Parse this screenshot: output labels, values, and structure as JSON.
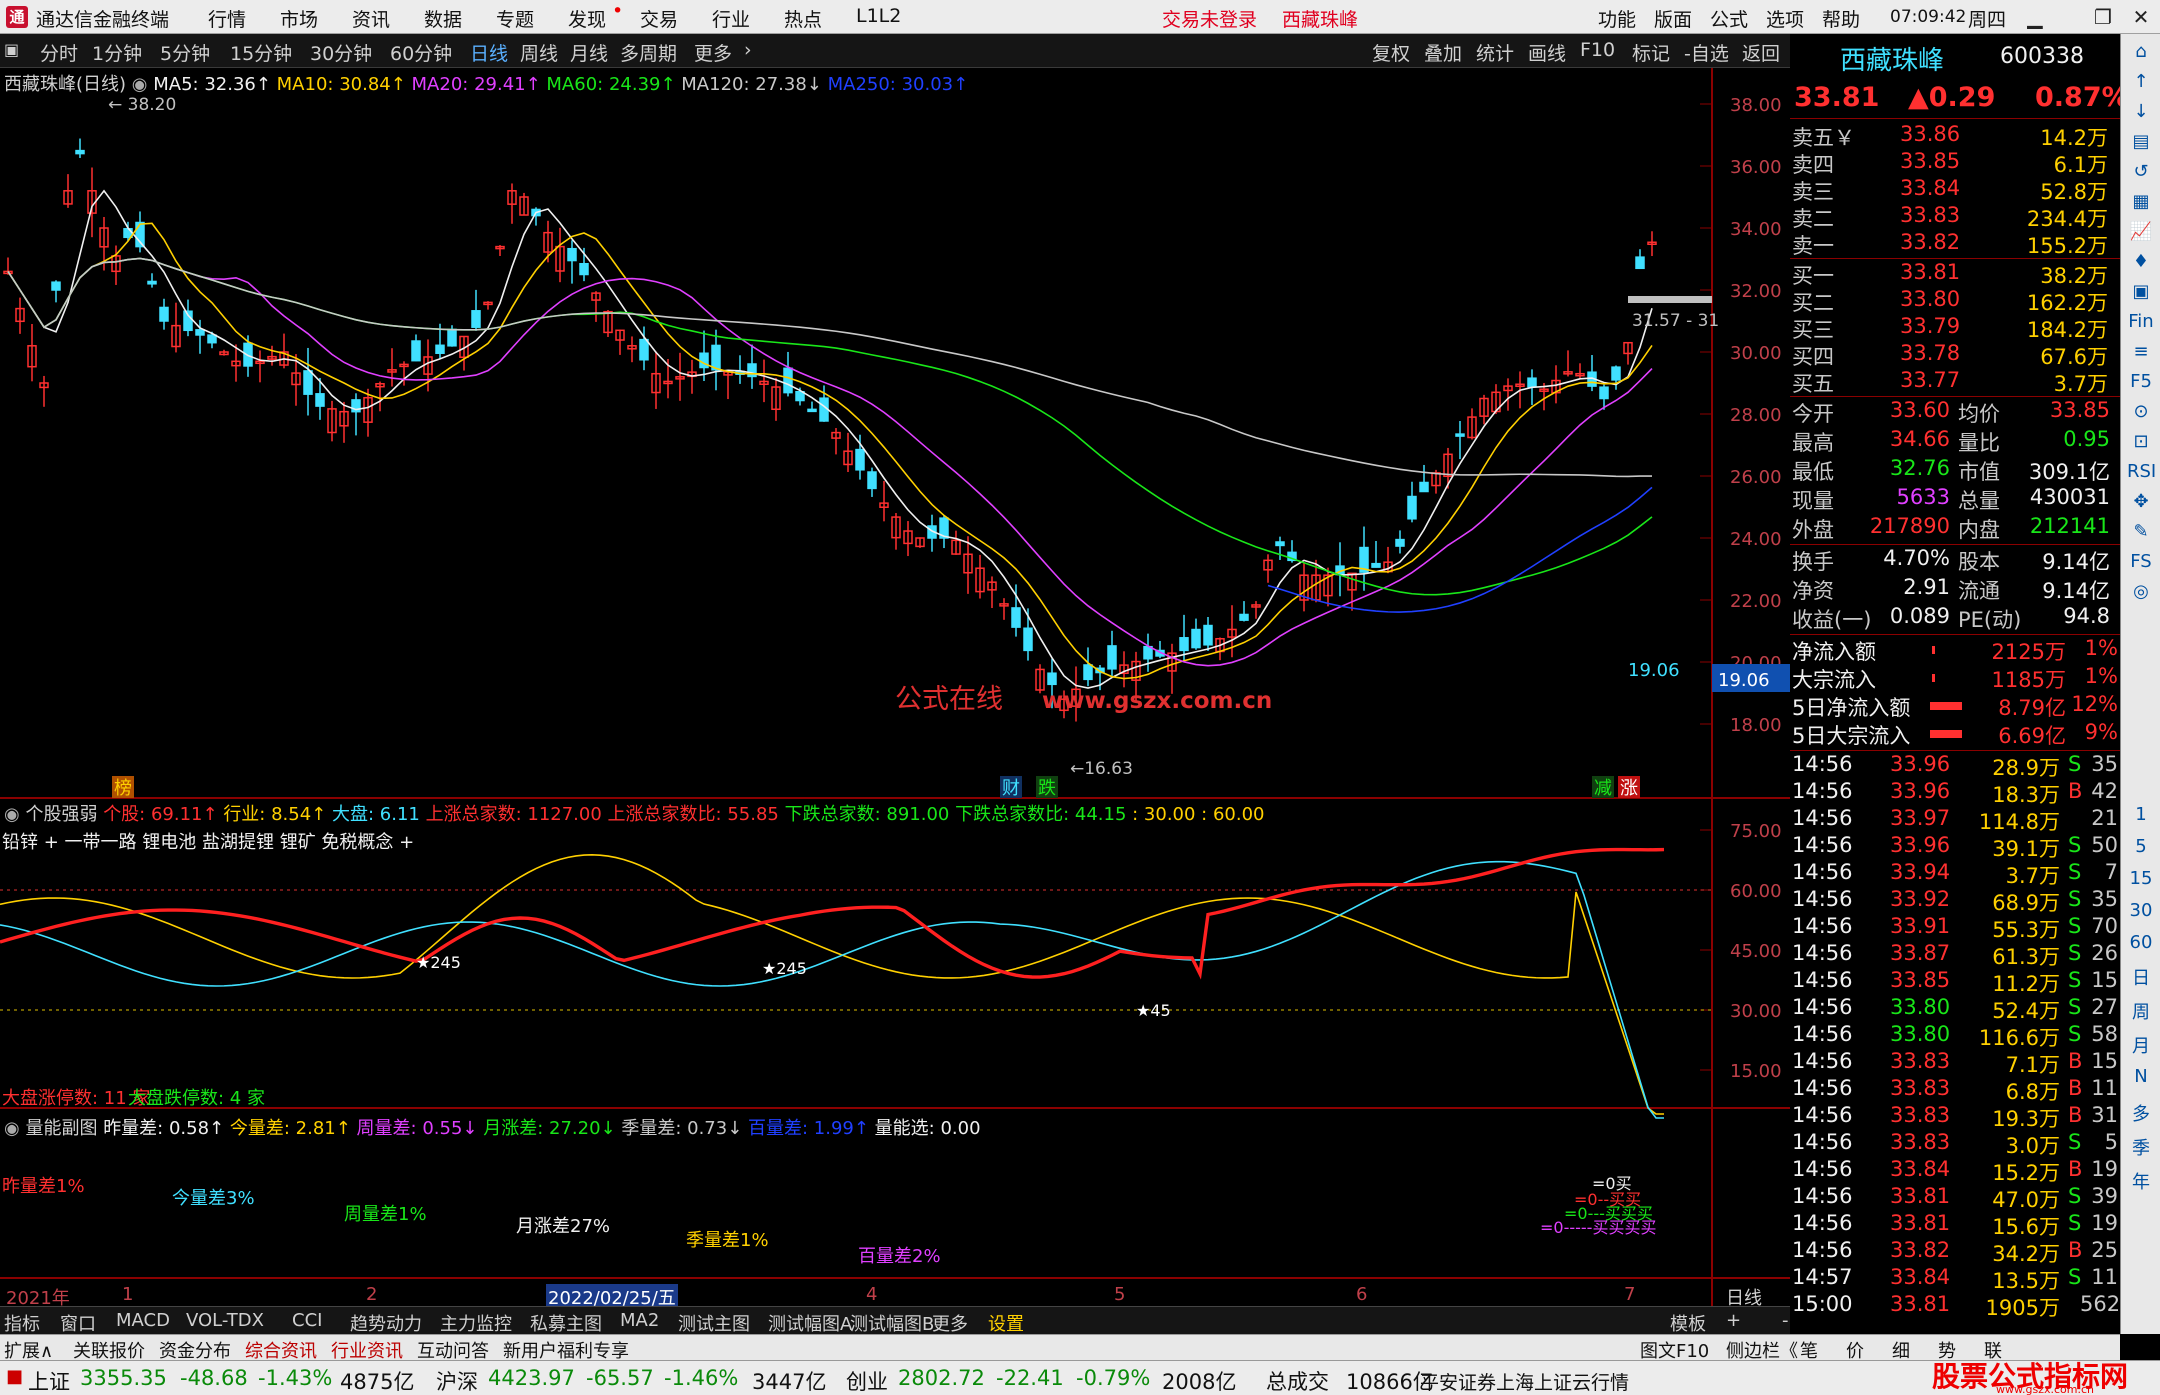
{
  "app": {
    "title": "通达信金融终端",
    "menu": [
      "行情",
      "市场",
      "资讯",
      "数据",
      "专题",
      "发现",
      "交易",
      "行业",
      "热点",
      "L1L2"
    ],
    "trade_status": "交易未登录",
    "stock_name_red": "西藏珠峰",
    "right_menu": [
      "功能",
      "版面",
      "公式",
      "选项",
      "帮助"
    ],
    "time": "07:09:42",
    "weekday": "周四"
  },
  "toolbar": {
    "periods": [
      "分时",
      "1分钟",
      "5分钟",
      "15分钟",
      "30分钟",
      "60分钟",
      "日线",
      "周线",
      "月线",
      "多周期",
      "更多"
    ],
    "active": "日线",
    "tools": [
      "复权",
      "叠加",
      "统计",
      "画线",
      "F10",
      "标记",
      "-自选",
      "返回"
    ]
  },
  "main": {
    "caption": "西藏珠峰(日线)",
    "ma": [
      {
        "t": "MA5: 32.36",
        "c": "#f0f0f0"
      },
      {
        "t": "MA10: 30.84",
        "c": "#ffd000"
      },
      {
        "t": "MA20: 29.41",
        "c": "#e040ff"
      },
      {
        "t": "MA60: 24.39",
        "c": "#19e619"
      },
      {
        "t": "MA120: 27.38",
        "c": "#c8c8c8"
      },
      {
        "t": "MA250: 30.03",
        "c": "#2040ff"
      }
    ],
    "yticks": [
      "38.00",
      "36.00",
      "34.00",
      "32.00",
      "30.00",
      "28.00",
      "26.00",
      "24.00",
      "22.00",
      "20.00",
      "18.00"
    ],
    "high_label": "38.20",
    "low_label": "16.63",
    "range_label": "31.57 - 31",
    "cursor_price": "19.06",
    "watermark1": "公式在线",
    "watermark2": "www.gszx.com.cn",
    "flags": [
      "榜",
      "财",
      "跌",
      "减",
      "涨"
    ]
  },
  "ind1": {
    "caption": "个股强弱",
    "items": [
      {
        "t": "个股: 69.11",
        "c": "#ff3030"
      },
      {
        "t": "行业: 8.54",
        "c": "#ffd000"
      },
      {
        "t": "大盘: 6.11",
        "c": "#40e0ff"
      },
      {
        "t": "上涨总家数: 1127.00",
        "c": "#ff3030"
      },
      {
        "t": "上涨总家数比: 55.85",
        "c": "#ff3030"
      },
      {
        "t": "下跌总家数: 891.00",
        "c": "#19e619"
      },
      {
        "t": "下跌总家数比: 44.15",
        "c": "#19e619"
      },
      {
        "t": ": 30.00 : 60.00",
        "c": "#ffd000"
      }
    ],
    "concepts": "铅锌 + 一带一路 锂电池 盐湖提锂 锂矿 免税概念 +",
    "yticks": [
      "75.00",
      "60.00",
      "45.00",
      "30.00",
      "15.00"
    ],
    "star": "245",
    "star2": "245",
    "star3": "45",
    "limit_up": "大盘涨停数: 11 家",
    "limit_down": "大盘跌停数: 4 家"
  },
  "ind2": {
    "caption": "量能副图",
    "items": [
      {
        "t": "昨量差: 0.58",
        "c": "#f0f0f0"
      },
      {
        "t": "今量差: 2.81",
        "c": "#ffd000"
      },
      {
        "t": "周量差: 0.55",
        "c": "#e040ff"
      },
      {
        "t": "月涨差: 27.20",
        "c": "#19e619"
      },
      {
        "t": "季量差: 0.73",
        "c": "#c8c8c8"
      },
      {
        "t": "百量差: 1.99",
        "c": "#2040ff"
      },
      {
        "t": "量能选: 0.00",
        "c": "#f0f0f0"
      }
    ],
    "labels": [
      {
        "t": "昨量差1%",
        "c": "#ff3030"
      },
      {
        "t": "今量差3%",
        "c": "#40e0ff"
      },
      {
        "t": "周量差1%",
        "c": "#19e619"
      },
      {
        "t": "月涨差27%",
        "c": "#f0f0f0"
      },
      {
        "t": "季量差1%",
        "c": "#ffd000"
      },
      {
        "t": "百量差2%",
        "c": "#e040ff"
      }
    ],
    "sig1": "=0买",
    "sig2": "=0--买买",
    "sig3": "=0---买买买",
    "sig4": "=0-----买买买买"
  },
  "xaxis": {
    "labels": [
      "2021年",
      "1",
      "2",
      "2022/02/25/五",
      "4",
      "5",
      "6",
      "7"
    ],
    "period": "日线"
  },
  "tabs": [
    "指标",
    "窗口",
    "MACD",
    "VOL-TDX",
    "CCI",
    "趋势动力",
    "主力监控",
    "私募主图",
    "MA2",
    "测试主图",
    "测试幅图A",
    "测试幅图B",
    "更多",
    "设置"
  ],
  "tabs_right": [
    "模板",
    "+",
    "-"
  ],
  "tabs2": [
    "扩展∧",
    "关联报价",
    "资金分布",
    "综合资讯",
    "行业资讯",
    "互动问答",
    "新用户福利专享"
  ],
  "tabs2_right": [
    "图文F10",
    "侧边栏《",
    "笔",
    "价",
    "细",
    "势",
    "联"
  ],
  "quote": {
    "name": "西藏珠峰",
    "code": "600338",
    "price": "33.81",
    "change": "▲0.29",
    "pct": "0.87%",
    "asks": [
      {
        "l": "卖五￥",
        "p": "33.86",
        "v": "14.2万"
      },
      {
        "l": "卖四",
        "p": "33.85",
        "v": "6.1万"
      },
      {
        "l": "卖三",
        "p": "33.84",
        "v": "52.8万"
      },
      {
        "l": "卖二",
        "p": "33.83",
        "v": "234.4万"
      },
      {
        "l": "卖一",
        "p": "33.82",
        "v": "155.2万"
      }
    ],
    "bids": [
      {
        "l": "买一",
        "p": "33.81",
        "v": "38.2万"
      },
      {
        "l": "买二",
        "p": "33.80",
        "v": "162.2万"
      },
      {
        "l": "买三",
        "p": "33.79",
        "v": "184.2万"
      },
      {
        "l": "买四",
        "p": "33.78",
        "v": "67.6万"
      },
      {
        "l": "买五",
        "p": "33.77",
        "v": "3.7万"
      }
    ],
    "stats": [
      [
        "今开",
        "33.60",
        "均价",
        "33.85"
      ],
      [
        "最高",
        "34.66",
        "量比",
        "0.95"
      ],
      [
        "最低",
        "32.76",
        "市值",
        "309.1亿"
      ],
      [
        "现量",
        "5633",
        "总量",
        "430031"
      ],
      [
        "外盘",
        "217890",
        "内盘",
        "212141"
      ]
    ],
    "stats2": [
      [
        "换手",
        "4.70%",
        "股本",
        "9.14亿"
      ],
      [
        "净资",
        "2.91",
        "流通",
        "9.14亿"
      ],
      [
        "收益(一)",
        "0.089",
        "PE(动)",
        "94.8"
      ]
    ],
    "flows": [
      [
        "净流入额",
        "2125万",
        "1%"
      ],
      [
        "大宗流入",
        "1185万",
        "1%"
      ],
      [
        "5日净流入额",
        "8.79亿",
        "12%"
      ],
      [
        "5日大宗流入",
        "6.69亿",
        "9%"
      ]
    ],
    "ticks": [
      [
        "14:56",
        "33.96",
        "28.9万",
        "S",
        "35"
      ],
      [
        "14:56",
        "33.96",
        "18.3万",
        "B",
        "42"
      ],
      [
        "14:56",
        "33.97",
        "114.8万",
        "",
        "21"
      ],
      [
        "14:56",
        "33.96",
        "39.1万",
        "S",
        "50"
      ],
      [
        "14:56",
        "33.94",
        "3.7万",
        "S",
        "7"
      ],
      [
        "14:56",
        "33.92",
        "68.9万",
        "S",
        "35"
      ],
      [
        "14:56",
        "33.91",
        "55.3万",
        "S",
        "70"
      ],
      [
        "14:56",
        "33.87",
        "61.3万",
        "S",
        "26"
      ],
      [
        "14:56",
        "33.85",
        "11.2万",
        "S",
        "15"
      ],
      [
        "14:56",
        "33.80",
        "52.4万",
        "S",
        "27"
      ],
      [
        "14:56",
        "33.80",
        "116.6万",
        "S",
        "58"
      ],
      [
        "14:56",
        "33.83",
        "7.1万",
        "B",
        "15"
      ],
      [
        "14:56",
        "33.83",
        "6.8万",
        "B",
        "11"
      ],
      [
        "14:56",
        "33.83",
        "19.3万",
        "B",
        "31"
      ],
      [
        "14:56",
        "33.83",
        "3.0万",
        "S",
        "5"
      ],
      [
        "14:56",
        "33.84",
        "15.2万",
        "B",
        "19"
      ],
      [
        "14:56",
        "33.81",
        "47.0万",
        "S",
        "39"
      ],
      [
        "14:56",
        "33.81",
        "15.6万",
        "S",
        "19"
      ],
      [
        "14:56",
        "33.82",
        "34.2万",
        "B",
        "25"
      ],
      [
        "14:57",
        "33.84",
        "13.5万",
        "S",
        "11"
      ],
      [
        "15:00",
        "33.81",
        "1905万",
        "",
        "562"
      ]
    ]
  },
  "rightbar": {
    "labels": [
      "日",
      "周",
      "月",
      "N",
      "多",
      "季",
      "年"
    ],
    "nums": [
      "1",
      "5",
      "15",
      "30",
      "60"
    ]
  },
  "status": {
    "sh": {
      "n": "上证",
      "v": "3355.35",
      "d": "-48.68",
      "p": "-1.43%",
      "a": "4875亿"
    },
    "sz": {
      "n": "沪深",
      "v": "4423.97",
      "d": "-65.57",
      "p": "-1.46%",
      "a": "3447亿"
    },
    "cy": {
      "n": "创业",
      "v": "2802.72",
      "d": "-22.41",
      "p": "-0.79%",
      "a": "2008亿"
    },
    "total_label": "总成交",
    "total": "10866亿",
    "broker": "平安证券上海上证云行情",
    "brand": "股票公式指标网",
    "brand_url": "www.gszx.com.cn"
  }
}
